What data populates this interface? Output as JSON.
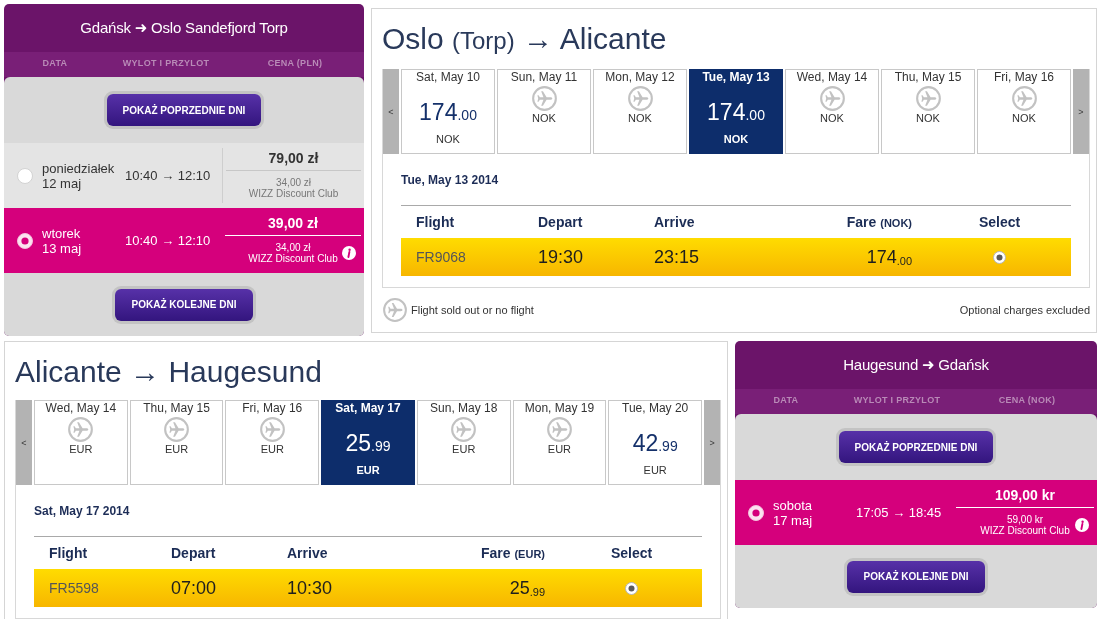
{
  "rows": [
    {
      "panels": [
        {
          "kind": "day_list",
          "title": "Gdańsk ➜ Oslo Sandefjord Torp",
          "columns": [
            "DATA",
            "WYLOT I PRZYLOT",
            "CENA (PLN)"
          ],
          "previous_button": "POKAŻ POPRZEDNIE DNI",
          "days": [
            {
              "weekday": "poniedziałek",
              "date": "12 maj",
              "times": "10:40 → 12:10",
              "price": "79,00 zł",
              "club_price": "34,00 zł",
              "club_name": "WIZZ Discount Club",
              "selected": false
            },
            {
              "weekday": "wtorek",
              "date": "13 maj",
              "times": "10:40 → 12:10",
              "price": "39,00 zł",
              "club_price": "34,00 zł",
              "club_name": "WIZZ Discount Club",
              "selected": true
            }
          ],
          "next_button": "POKAŻ KOLEJNE DNI"
        },
        {
          "kind": "fare_calendar",
          "title": {
            "origin": "Oslo",
            "airport": "(Torp)",
            "arrow": "→",
            "destination": "Alicante"
          },
          "previous_arrow": "<",
          "next_arrow": ">",
          "dates": [
            {
              "kind": "fare",
              "date": "Sat, May 10",
              "amount": "174",
              "fraction": ".00",
              "currency": "NOK",
              "selected": false
            },
            {
              "kind": "sold_out",
              "date": "Sun, May 11",
              "currency": "NOK",
              "selected": false
            },
            {
              "kind": "sold_out",
              "date": "Mon, May 12",
              "currency": "NOK",
              "selected": false
            },
            {
              "kind": "fare",
              "date": "Tue, May 13",
              "amount": "174",
              "fraction": ".00",
              "currency": "NOK",
              "selected": true
            },
            {
              "kind": "sold_out",
              "date": "Wed, May 14",
              "currency": "NOK",
              "selected": false
            },
            {
              "kind": "sold_out",
              "date": "Thu, May 15",
              "currency": "NOK",
              "selected": false
            },
            {
              "kind": "sold_out",
              "date": "Fri, May 16",
              "currency": "NOK",
              "selected": false
            }
          ],
          "date_heading": "Tue, May 13 2014",
          "columns": [
            {
              "label": "Flight"
            },
            {
              "label": "Depart"
            },
            {
              "label": "Arrive"
            },
            {
              "label": "Fare",
              "unit": "(NOK)"
            },
            {
              "label": "Select"
            }
          ],
          "flights": [
            {
              "flight": "FR9068",
              "depart": "19:30",
              "arrive": "23:15",
              "fare": "174",
              "fare_fraction": ".00",
              "selected": true
            }
          ],
          "legend": "Flight sold out or no flight",
          "note": "Optional charges excluded"
        }
      ]
    },
    {
      "panels": [
        {
          "kind": "fare_calendar",
          "title": {
            "origin": "Alicante",
            "arrow": "→",
            "destination": "Haugesund"
          },
          "previous_arrow": "<",
          "next_arrow": ">",
          "dates": [
            {
              "kind": "sold_out",
              "date": "Wed, May 14",
              "currency": "EUR",
              "selected": false
            },
            {
              "kind": "sold_out",
              "date": "Thu, May 15",
              "currency": "EUR",
              "selected": false
            },
            {
              "kind": "sold_out",
              "date": "Fri, May 16",
              "currency": "EUR",
              "selected": false
            },
            {
              "kind": "fare",
              "date": "Sat, May 17",
              "amount": "25",
              "fraction": ".99",
              "currency": "EUR",
              "selected": true
            },
            {
              "kind": "sold_out",
              "date": "Sun, May 18",
              "currency": "EUR",
              "selected": false
            },
            {
              "kind": "sold_out",
              "date": "Mon, May 19",
              "currency": "EUR",
              "selected": false
            },
            {
              "kind": "fare",
              "date": "Tue, May 20",
              "amount": "42",
              "fraction": ".99",
              "currency": "EUR",
              "selected": false
            }
          ],
          "date_heading": "Sat, May 17 2014",
          "columns": [
            {
              "label": "Flight"
            },
            {
              "label": "Depart"
            },
            {
              "label": "Arrive"
            },
            {
              "label": "Fare",
              "unit": "(EUR)"
            },
            {
              "label": "Select"
            }
          ],
          "flights": [
            {
              "flight": "FR5598",
              "depart": "07:00",
              "arrive": "10:30",
              "fare": "25",
              "fare_fraction": ".99",
              "selected": true
            }
          ]
        },
        {
          "kind": "day_list",
          "title": "Haugesund ➜ Gdańsk",
          "columns": [
            "DATA",
            "WYLOT I PRZYLOT",
            "CENA (NOK)"
          ],
          "previous_button": "POKAŻ POPRZEDNIE DNI",
          "days": [
            {
              "weekday": "sobota",
              "date": "17 maj",
              "times": "17:05 → 18:45",
              "price": "109,00 kr",
              "club_price": "59,00 kr",
              "club_name": "WIZZ Discount Club",
              "selected": true
            }
          ],
          "next_button": "POKAŻ KOLEJNE DNI"
        }
      ]
    }
  ]
}
